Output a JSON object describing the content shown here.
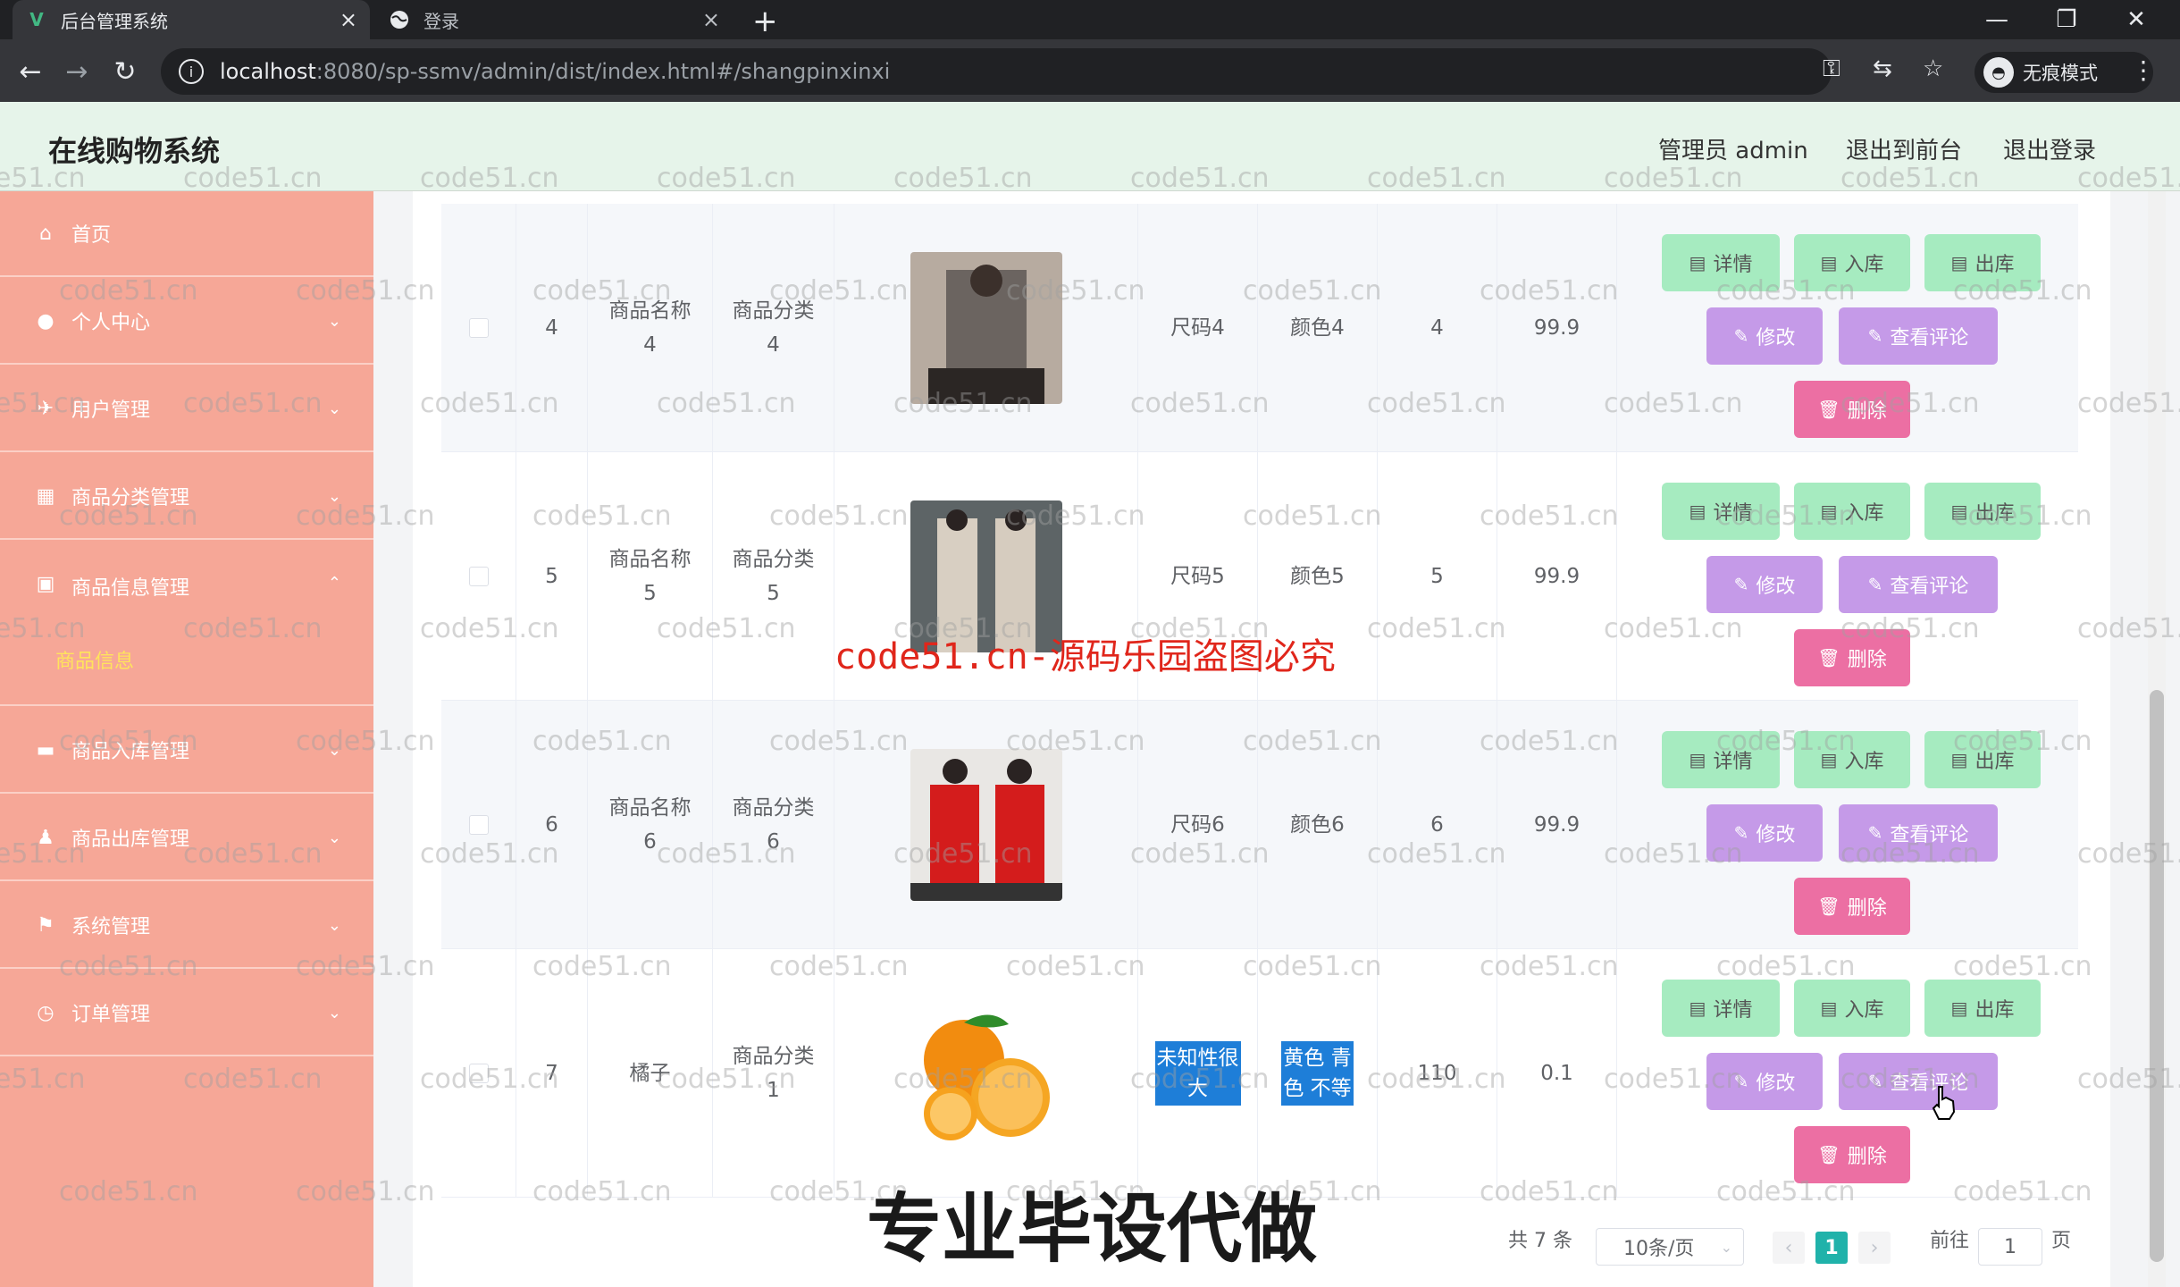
{
  "browser": {
    "tabs": [
      {
        "title": "后台管理系统",
        "favicon": "V",
        "active": true
      },
      {
        "title": "登录",
        "favicon": "globe",
        "active": false
      }
    ],
    "url_host": "localhost",
    "url_path": ":8080/sp-ssmv/admin/dist/index.html#/shangpinxinxi",
    "incognito_label": "无痕模式",
    "tab_close": "×",
    "new_tab": "+"
  },
  "header": {
    "brand": "在线购物系统",
    "admin": "管理员 admin",
    "front": "退出到前台",
    "logout": "退出登录"
  },
  "sidebar": {
    "items": [
      {
        "label": "首页",
        "icon": "home-icon"
      },
      {
        "label": "个人中心",
        "icon": "user-icon"
      },
      {
        "label": "用户管理",
        "icon": "pin-icon"
      },
      {
        "label": "商品分类管理",
        "icon": "grid-icon"
      },
      {
        "label": "商品信息管理",
        "icon": "box-icon"
      },
      {
        "label": "商品入库管理",
        "icon": "video-icon"
      },
      {
        "label": "商品出库管理",
        "icon": "person-icon"
      },
      {
        "label": "系统管理",
        "icon": "flag-icon"
      },
      {
        "label": "订单管理",
        "icon": "clock-icon"
      }
    ],
    "subitem": "商品信息"
  },
  "table": {
    "rows": [
      {
        "id": "4",
        "name": "商品名称\n4",
        "category": "商品分类\n4",
        "size": "尺码4",
        "color": "颜色4",
        "qty": "4",
        "price": "99.9",
        "highlight": false
      },
      {
        "id": "5",
        "name": "商品名称\n5",
        "category": "商品分类\n5",
        "size": "尺码5",
        "color": "颜色5",
        "qty": "5",
        "price": "99.9",
        "highlight": false
      },
      {
        "id": "6",
        "name": "商品名称\n6",
        "category": "商品分类\n6",
        "size": "尺码6",
        "color": "颜色6",
        "qty": "6",
        "price": "99.9",
        "highlight": false
      },
      {
        "id": "7",
        "name": "橘子",
        "category": "商品分类\n1",
        "size": "未知性很\n大",
        "color": "黄色 青\n色 不等",
        "qty": "110",
        "price": "0.1",
        "highlight": true
      }
    ],
    "actions": {
      "detail": "详情",
      "stock_in": "入库",
      "stock_out": "出库",
      "edit": "修改",
      "comments": "查看评论",
      "delete": "删除"
    }
  },
  "pagination": {
    "total": "共 7 条",
    "page_size": "10条/页",
    "current": "1",
    "goto_prefix": "前往",
    "goto_value": "1",
    "goto_suffix": "页"
  },
  "watermarks": {
    "repeat": "code51.cn",
    "red": "code51.cn-源码乐园盗图必究",
    "big": "专业毕设代做"
  }
}
